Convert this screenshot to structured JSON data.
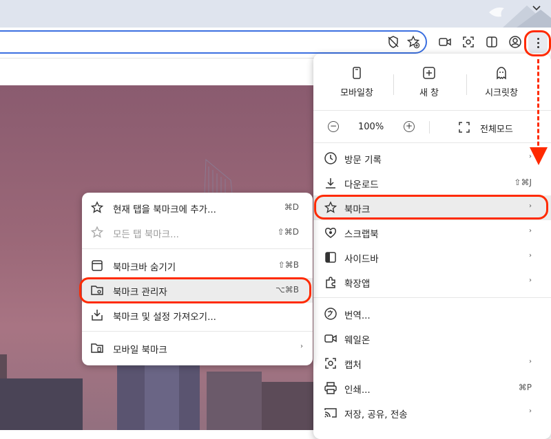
{
  "menu": {
    "quick": {
      "mobile_window": "모바일창",
      "new_window": "새 창",
      "secret_window": "시크릿창"
    },
    "zoom": {
      "minus": "−",
      "level": "100%",
      "plus": "+",
      "fullscreen": "전체모드"
    },
    "items": [
      {
        "label": "방문 기록",
        "shortcut": "",
        "arrow": "›"
      },
      {
        "label": "다운로드",
        "shortcut": "⇧⌘J",
        "arrow": ""
      },
      {
        "label": "북마크",
        "shortcut": "",
        "arrow": "›"
      },
      {
        "label": "스크랩북",
        "shortcut": "",
        "arrow": "›"
      },
      {
        "label": "사이드바",
        "shortcut": "",
        "arrow": "›"
      },
      {
        "label": "확장앱",
        "shortcut": "",
        "arrow": "›"
      },
      {
        "label": "번역...",
        "shortcut": "",
        "arrow": ""
      },
      {
        "label": "웨일온",
        "shortcut": "",
        "arrow": ""
      },
      {
        "label": "캡처",
        "shortcut": "",
        "arrow": "›"
      },
      {
        "label": "인쇄...",
        "shortcut": "⌘P",
        "arrow": ""
      },
      {
        "label": "저장, 공유, 전송",
        "shortcut": "",
        "arrow": "›"
      }
    ]
  },
  "bookmark_submenu": {
    "items": [
      {
        "label": "현재 탭을 북마크에 추가...",
        "shortcut": "⌘D"
      },
      {
        "label": "모든 탭 북마크...",
        "shortcut": "⇧⌘D"
      },
      {
        "label": "북마크바 숨기기",
        "shortcut": "⇧⌘B"
      },
      {
        "label": "북마크 관리자",
        "shortcut": "⌥⌘B"
      },
      {
        "label": "북마크 및 설정 가져오기...",
        "shortcut": ""
      },
      {
        "label": "모바일 북마크",
        "shortcut": "",
        "arrow": "›"
      }
    ]
  },
  "colors": {
    "annotation": "#ff2a00",
    "omnibox_border": "#3b6fe0",
    "tabstrip": "#dfe4ee",
    "highlight": "#ececec"
  },
  "icons": {
    "toolbar": [
      "privacy-shield-icon",
      "star-add-icon",
      "video-call-icon",
      "capture-icon",
      "sidebar-icon",
      "profile-icon",
      "more-vertical-icon"
    ]
  }
}
